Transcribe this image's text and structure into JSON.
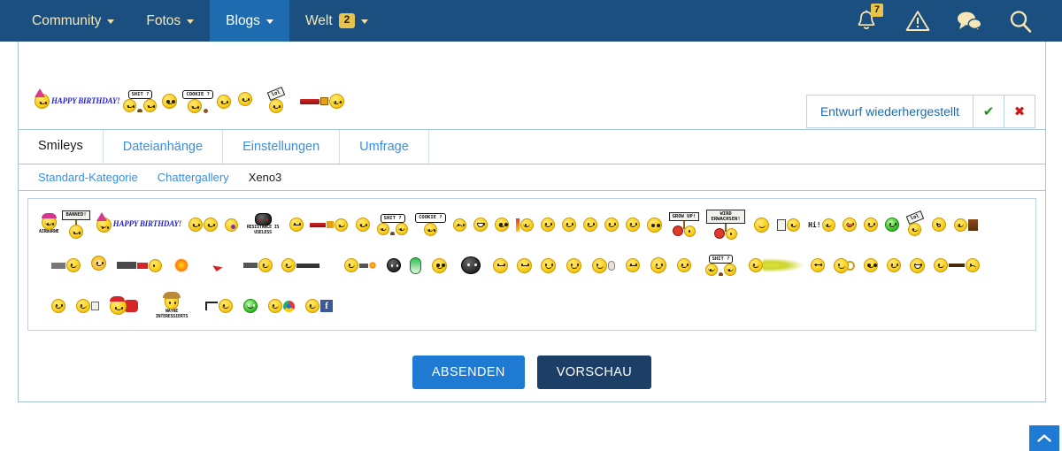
{
  "nav": {
    "items": [
      {
        "label": "Community",
        "has_caret": true,
        "active": false,
        "badge": null
      },
      {
        "label": "Fotos",
        "has_caret": true,
        "active": false,
        "badge": null
      },
      {
        "label": "Blogs",
        "has_caret": true,
        "active": true,
        "badge": null
      },
      {
        "label": "Welt",
        "has_caret": true,
        "active": false,
        "badge": "2"
      }
    ],
    "icons": [
      {
        "name": "notification-bell-icon",
        "badge": "7"
      },
      {
        "name": "warning-triangle-icon",
        "badge": null
      },
      {
        "name": "chat-bubbles-icon",
        "badge": null
      },
      {
        "name": "search-icon",
        "badge": null
      }
    ],
    "colors": {
      "bar_bg": "#1a4f80",
      "active_bg": "#1f6bb0",
      "text": "#f7e7b6",
      "badge_bg": "#e8c44e"
    }
  },
  "draft": {
    "message": "Entwurf wiederhergestellt",
    "accept_icon": "check-icon",
    "accept_glyph": "✔",
    "reject_icon": "close-icon",
    "reject_glyph": "✖",
    "accept_color": "#149414",
    "reject_color": "#d01818"
  },
  "tabs": [
    {
      "label": "Smileys",
      "active": true
    },
    {
      "label": "Dateianhänge",
      "active": false
    },
    {
      "label": "Einstellungen",
      "active": false
    },
    {
      "label": "Umfrage",
      "active": false
    }
  ],
  "subcategories": [
    {
      "label": "Standard-Kategorie",
      "active": false
    },
    {
      "label": "Chattergallery",
      "active": false
    },
    {
      "label": "Xeno3",
      "active": true
    }
  ],
  "editor_smileys": [
    {
      "name": "happy-birthday",
      "caption": "HAPPY BIRTHDAY!"
    },
    {
      "name": "shit-question",
      "caption": "SHIT ?"
    },
    {
      "name": "shocked-face",
      "caption": ""
    },
    {
      "name": "goggles-face",
      "caption": ""
    },
    {
      "name": "cookie-question",
      "caption": "COOKIE ?"
    },
    {
      "name": "crying-face",
      "caption": ""
    },
    {
      "name": "sleeping-face",
      "caption": ""
    },
    {
      "name": "hammer-lol",
      "caption": "lol"
    },
    {
      "name": "chainsaw-face",
      "caption": ""
    }
  ],
  "picker": {
    "row1": [
      {
        "name": "airborne",
        "caption": "AIRBORNE"
      },
      {
        "name": "banned-sign",
        "caption": "BANNED!"
      },
      {
        "name": "happy-birthday",
        "caption": "HAPPY BIRTHDAY!"
      },
      {
        "name": "cheers-beer",
        "caption": ""
      },
      {
        "name": "purple-eye",
        "caption": ""
      },
      {
        "name": "resistance-is-useless",
        "caption": "RESISTANCE IS USELESS"
      },
      {
        "name": "zipper-mouth",
        "caption": ""
      },
      {
        "name": "chainsaw-face",
        "caption": ""
      },
      {
        "name": "smug-face",
        "caption": ""
      },
      {
        "name": "shit-question",
        "caption": "SHIT ?"
      },
      {
        "name": "cookie-question",
        "caption": "COOKIE ?"
      },
      {
        "name": "crying-face",
        "caption": ""
      },
      {
        "name": "teeth-face",
        "caption": ""
      },
      {
        "name": "shocked-face",
        "caption": ""
      },
      {
        "name": "thermometer-face",
        "caption": ""
      },
      {
        "name": "sick-face",
        "caption": ""
      },
      {
        "name": "dizzy-face",
        "caption": ""
      },
      {
        "name": "grin-face",
        "caption": ""
      },
      {
        "name": "scared-face",
        "caption": ""
      },
      {
        "name": "laughing-face",
        "caption": ""
      },
      {
        "name": "goggles-face",
        "caption": ""
      },
      {
        "name": "grow-up-sign",
        "caption": "GROW UP!"
      },
      {
        "name": "wird-erwachsen-sign",
        "caption": "WIRD ERWACHSEN!"
      },
      {
        "name": "bowing-face",
        "caption": ""
      },
      {
        "name": "clipboard-face",
        "caption": ""
      },
      {
        "name": "hi-wave",
        "caption": "Hi!"
      },
      {
        "name": "tongue-face",
        "caption": ""
      },
      {
        "name": "thinking-face",
        "caption": ""
      },
      {
        "name": "green-sick-face",
        "caption": ""
      },
      {
        "name": "hammer-lol",
        "caption": "lol"
      },
      {
        "name": "whistle-face",
        "caption": ""
      },
      {
        "name": "reading-face",
        "caption": ""
      }
    ],
    "row2": [
      {
        "name": "minigun-face",
        "caption": ""
      },
      {
        "name": "sun-face",
        "caption": ""
      },
      {
        "name": "rocket-launcher-face",
        "caption": ""
      },
      {
        "name": "explosion",
        "caption": ""
      },
      {
        "name": "dart",
        "caption": ""
      },
      {
        "name": "pistol-face",
        "caption": ""
      },
      {
        "name": "sniper-face",
        "caption": ""
      },
      {
        "name": "flamethrower-face",
        "caption": ""
      },
      {
        "name": "ninja-face",
        "caption": ""
      },
      {
        "name": "green-pill",
        "caption": ""
      },
      {
        "name": "cheer-face",
        "caption": ""
      },
      {
        "name": "black-explosion-face",
        "caption": ""
      },
      {
        "name": "zipped-mouth-face",
        "caption": ""
      },
      {
        "name": "angry-point-face",
        "caption": ""
      },
      {
        "name": "whisper-face",
        "caption": ""
      },
      {
        "name": "happy-arms-face",
        "caption": ""
      },
      {
        "name": "mouse-face",
        "caption": ""
      },
      {
        "name": "neutral-face",
        "caption": ""
      },
      {
        "name": "flexing-face",
        "caption": ""
      },
      {
        "name": "smile-face",
        "caption": ""
      },
      {
        "name": "shit-question",
        "caption": "SHIT ?"
      },
      {
        "name": "fart-cloud-face",
        "caption": ""
      },
      {
        "name": "dead-face",
        "caption": ""
      },
      {
        "name": "magnifier-face",
        "caption": ""
      },
      {
        "name": "glasses-face",
        "caption": ""
      },
      {
        "name": "giggle-face",
        "caption": ""
      },
      {
        "name": "big-grin-face",
        "caption": ""
      },
      {
        "name": "arrow-hit-face",
        "caption": ""
      },
      {
        "name": "sad-face",
        "caption": ""
      }
    ],
    "row3": [
      {
        "name": "simple-smile",
        "caption": ""
      },
      {
        "name": "waving-flag-face",
        "caption": ""
      },
      {
        "name": "santa-face",
        "caption": ""
      },
      {
        "name": "wayne-interessiert",
        "caption": "WAYNE INTERESSIERTS"
      },
      {
        "name": "whip-face",
        "caption": ""
      },
      {
        "name": "green-monster-face",
        "caption": ""
      },
      {
        "name": "chrome-logo-face",
        "caption": ""
      },
      {
        "name": "facebook-face",
        "caption": ""
      }
    ]
  },
  "actions": {
    "submit_label": "ABSENDEN",
    "preview_label": "VORSCHAU",
    "submit_color": "#1f7ad4",
    "preview_color": "#1b3f66"
  },
  "scroll_top": {
    "icon": "chevron-up-icon",
    "color": "#1f7ad4"
  }
}
